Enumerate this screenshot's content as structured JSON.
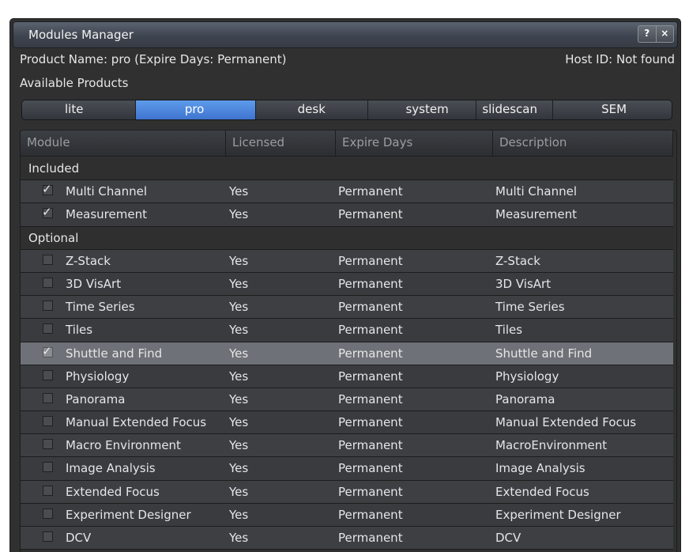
{
  "window": {
    "title": "Modules Manager",
    "help_button": "?",
    "close_button": "×"
  },
  "info": {
    "product_name": "Product Name: pro (Expire Days: Permanent)",
    "host_id": "Host ID: Not found",
    "available_products": "Available Products"
  },
  "tabs": [
    {
      "label": "lite",
      "active": false
    },
    {
      "label": "pro",
      "active": true
    },
    {
      "label": "desk",
      "active": false
    },
    {
      "label": "system",
      "active": false
    },
    {
      "label": "slidescan",
      "active": false
    },
    {
      "label": "SEM",
      "active": false
    }
  ],
  "table": {
    "columns": [
      "Module",
      "Licensed",
      "Expire Days",
      "Description"
    ],
    "rows": [
      {
        "type": "category",
        "label": "Included"
      },
      {
        "type": "module",
        "checked": true,
        "module": "Multi Channel",
        "licensed": "Yes",
        "expire": "Permanent",
        "description": "Multi Channel"
      },
      {
        "type": "module",
        "checked": true,
        "module": "Measurement",
        "licensed": "Yes",
        "expire": "Permanent",
        "description": "Measurement"
      },
      {
        "type": "category",
        "label": "Optional"
      },
      {
        "type": "module",
        "checked": false,
        "module": "Z-Stack",
        "licensed": "Yes",
        "expire": "Permanent",
        "description": "Z-Stack"
      },
      {
        "type": "module",
        "checked": false,
        "module": "3D VisArt",
        "licensed": "Yes",
        "expire": "Permanent",
        "description": "3D VisArt"
      },
      {
        "type": "module",
        "checked": false,
        "module": "Time Series",
        "licensed": "Yes",
        "expire": "Permanent",
        "description": "Time Series"
      },
      {
        "type": "module",
        "checked": false,
        "module": "Tiles",
        "licensed": "Yes",
        "expire": "Permanent",
        "description": "Tiles"
      },
      {
        "type": "module",
        "checked": true,
        "selected": true,
        "module": "Shuttle and Find",
        "licensed": "Yes",
        "expire": "Permanent",
        "description": "Shuttle and Find"
      },
      {
        "type": "module",
        "checked": false,
        "module": "Physiology",
        "licensed": "Yes",
        "expire": "Permanent",
        "description": "Physiology"
      },
      {
        "type": "module",
        "checked": false,
        "module": "Panorama",
        "licensed": "Yes",
        "expire": "Permanent",
        "description": "Panorama"
      },
      {
        "type": "module",
        "checked": false,
        "module": "Manual Extended Focus",
        "licensed": "Yes",
        "expire": "Permanent",
        "description": "Manual Extended Focus"
      },
      {
        "type": "module",
        "checked": false,
        "module": "Macro Environment",
        "licensed": "Yes",
        "expire": "Permanent",
        "description": "MacroEnvironment"
      },
      {
        "type": "module",
        "checked": false,
        "module": "Image Analysis",
        "licensed": "Yes",
        "expire": "Permanent",
        "description": "Image Analysis"
      },
      {
        "type": "module",
        "checked": false,
        "module": "Extended Focus",
        "licensed": "Yes",
        "expire": "Permanent",
        "description": "Extended Focus"
      },
      {
        "type": "module",
        "checked": false,
        "module": "Experiment Designer",
        "licensed": "Yes",
        "expire": "Permanent",
        "description": "Experiment Designer"
      },
      {
        "type": "module",
        "checked": false,
        "module": "DCV",
        "licensed": "Yes",
        "expire": "Permanent",
        "description": "DCV"
      }
    ]
  }
}
